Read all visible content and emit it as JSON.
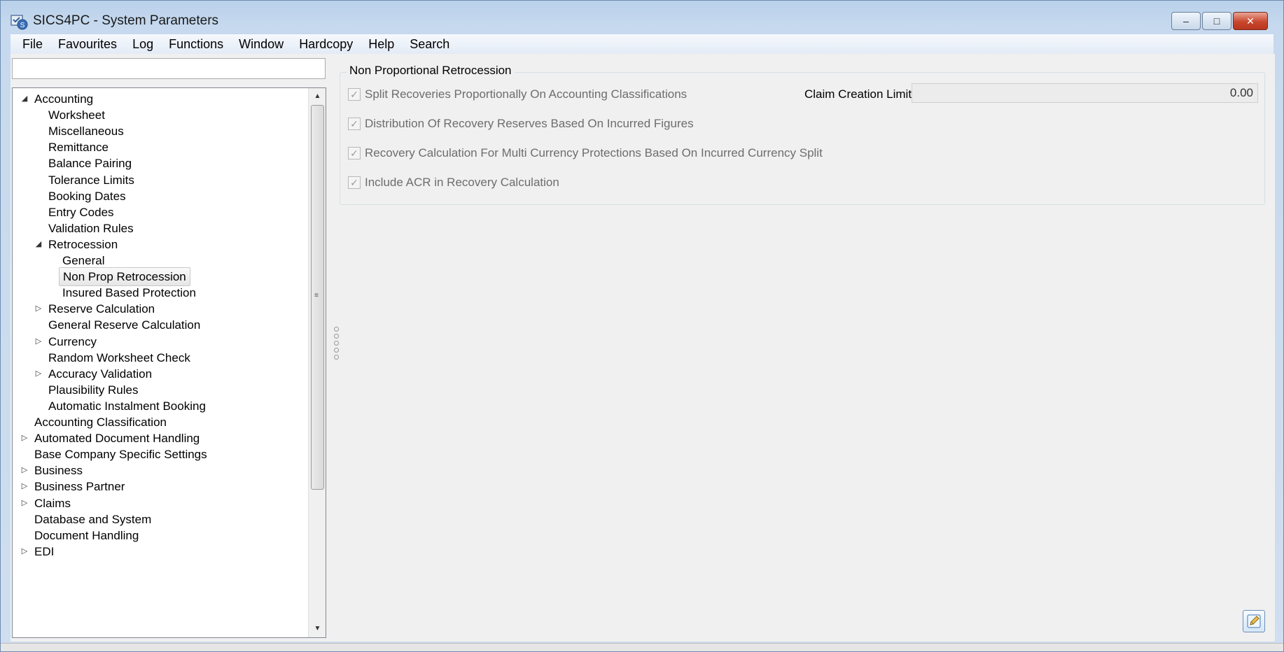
{
  "window": {
    "title": "SICS4PC - System Parameters",
    "minimize": "–",
    "maximize": "□",
    "close": "✕"
  },
  "menu": [
    "File",
    "Favourites",
    "Log",
    "Functions",
    "Window",
    "Hardcopy",
    "Help",
    "Search"
  ],
  "search": {
    "value": "",
    "placeholder": ""
  },
  "tree": [
    {
      "label": "Accounting",
      "level": 0,
      "expander": "expanded"
    },
    {
      "label": "Worksheet",
      "level": 1,
      "expander": "none"
    },
    {
      "label": "Miscellaneous",
      "level": 1,
      "expander": "none"
    },
    {
      "label": "Remittance",
      "level": 1,
      "expander": "none"
    },
    {
      "label": "Balance Pairing",
      "level": 1,
      "expander": "none"
    },
    {
      "label": "Tolerance Limits",
      "level": 1,
      "expander": "none"
    },
    {
      "label": "Booking Dates",
      "level": 1,
      "expander": "none"
    },
    {
      "label": "Entry Codes",
      "level": 1,
      "expander": "none"
    },
    {
      "label": "Validation Rules",
      "level": 1,
      "expander": "none"
    },
    {
      "label": "Retrocession",
      "level": 1,
      "expander": "expanded"
    },
    {
      "label": "General",
      "level": 2,
      "expander": "none"
    },
    {
      "label": "Non Prop Retrocession",
      "level": 2,
      "expander": "none",
      "selected": true
    },
    {
      "label": "Insured Based Protection",
      "level": 2,
      "expander": "none"
    },
    {
      "label": "Reserve Calculation",
      "level": 1,
      "expander": "collapsed"
    },
    {
      "label": "General Reserve Calculation",
      "level": 1,
      "expander": "none"
    },
    {
      "label": "Currency",
      "level": 1,
      "expander": "collapsed"
    },
    {
      "label": "Random Worksheet Check",
      "level": 1,
      "expander": "none"
    },
    {
      "label": "Accuracy Validation",
      "level": 1,
      "expander": "collapsed"
    },
    {
      "label": "Plausibility Rules",
      "level": 1,
      "expander": "none"
    },
    {
      "label": "Automatic Instalment Booking",
      "level": 1,
      "expander": "none"
    },
    {
      "label": "Accounting Classification",
      "level": 0,
      "expander": "none"
    },
    {
      "label": "Automated Document Handling",
      "level": 0,
      "expander": "collapsed"
    },
    {
      "label": "Base Company Specific Settings",
      "level": 0,
      "expander": "none"
    },
    {
      "label": "Business",
      "level": 0,
      "expander": "collapsed"
    },
    {
      "label": "Business Partner",
      "level": 0,
      "expander": "collapsed"
    },
    {
      "label": "Claims",
      "level": 0,
      "expander": "collapsed"
    },
    {
      "label": "Database and System",
      "level": 0,
      "expander": "none"
    },
    {
      "label": "Document Handling",
      "level": 0,
      "expander": "none"
    },
    {
      "label": "EDI",
      "level": 0,
      "expander": "collapsed"
    }
  ],
  "panel": {
    "group_title": "Non Proportional Retrocession",
    "checkboxes": [
      {
        "label": "Split Recoveries Proportionally On Accounting Classifications",
        "checked": true
      },
      {
        "label": "Distribution Of Recovery Reserves Based On Incurred Figures",
        "checked": true
      },
      {
        "label": "Recovery Calculation For Multi Currency Protections Based On Incurred Currency Split",
        "checked": true
      },
      {
        "label": "Include ACR in Recovery Calculation",
        "checked": true
      }
    ],
    "claim_limit_label": "Claim Creation Limit",
    "claim_limit_value": "0.00"
  },
  "icons": {
    "app": "app-icon",
    "edit": "pencil-edit-icon"
  }
}
